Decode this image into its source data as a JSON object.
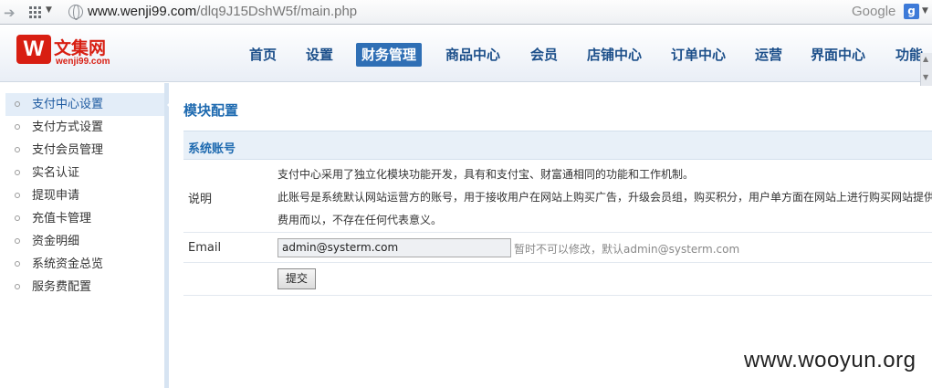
{
  "browser": {
    "url_host": "www.wenji99.com",
    "url_path": "/dlq9J15DshW5f/main.php",
    "search_engine": "Google"
  },
  "header": {
    "logo_mark": "W",
    "logo_cn": "文集网",
    "logo_en": "wenji99.com",
    "nav": [
      "首页",
      "设置",
      "财务管理",
      "商品中心",
      "会员",
      "店铺中心",
      "订单中心",
      "运营",
      "界面中心",
      "功能"
    ],
    "active_nav": "财务管理"
  },
  "sidebar": {
    "items": [
      "支付中心设置",
      "支付方式设置",
      "支付会员管理",
      "实名认证",
      "提现申请",
      "充值卡管理",
      "资金明细",
      "系统资金总览",
      "服务费配置"
    ],
    "active": "支付中心设置"
  },
  "main": {
    "title": "模块配置",
    "section": "系统账号",
    "desc_label": "说明",
    "desc_lines": [
      "支付中心采用了独立化模块功能开发，具有和支付宝、财富通相同的功能和工作机制。",
      "此账号是系统默认网站运营方的账号，用于接收用户在网站上购买广告，升级会员组，购买积分，用户单方面在网站上进行购买网站提供",
      "费用而以，不存在任何代表意义。"
    ],
    "email_label": "Email",
    "email_value": "admin@systerm.com",
    "email_hint": "暂时不可以修改，默认admin@systerm.com",
    "submit_label": "提交"
  },
  "watermark": "www.wooyun.org"
}
